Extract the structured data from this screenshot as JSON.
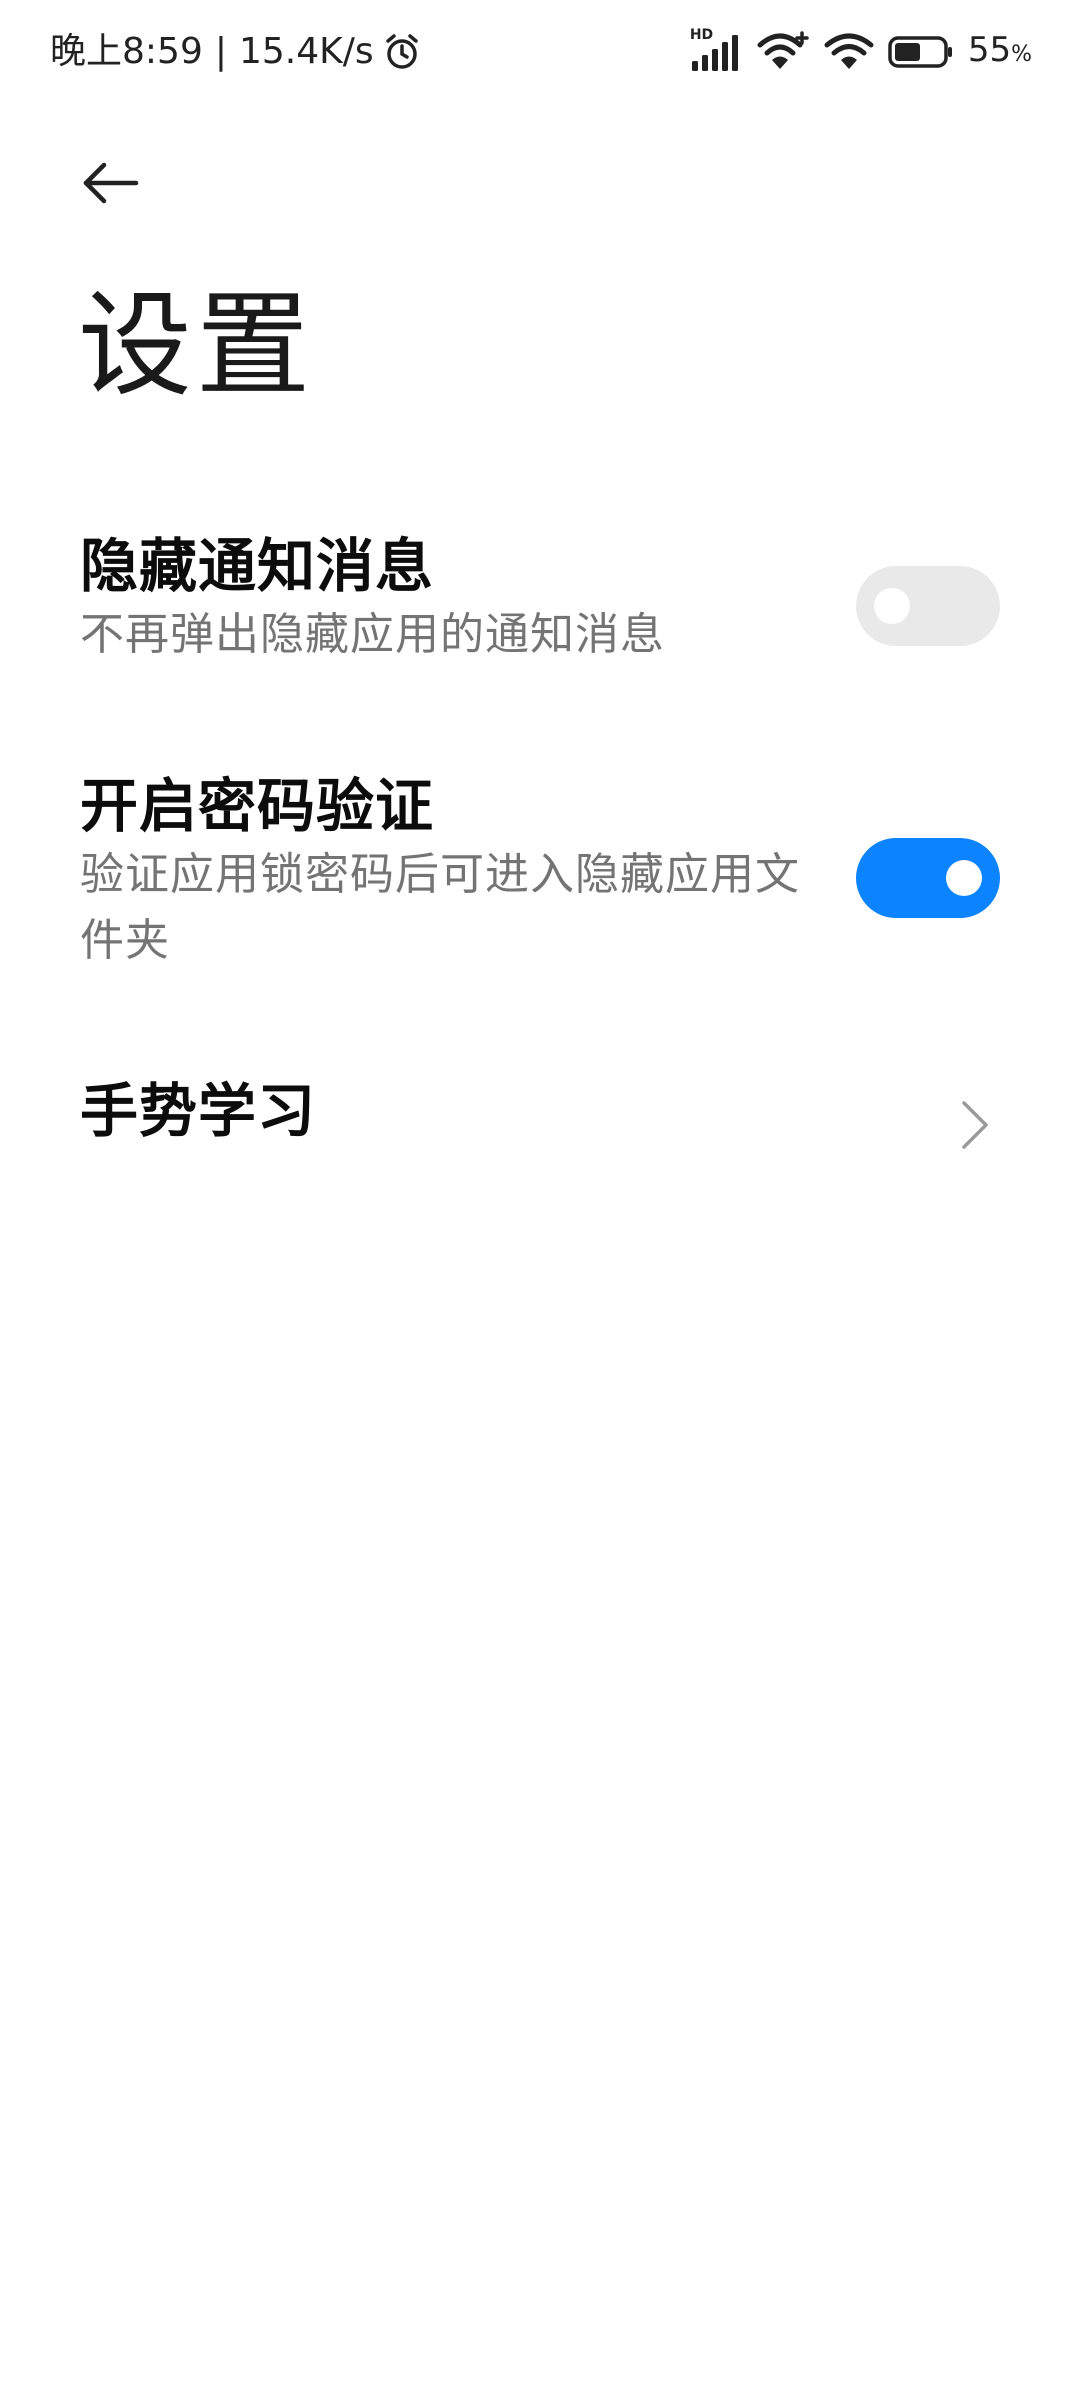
{
  "status_bar": {
    "time": "晚上8:59",
    "separator": "|",
    "net_speed": "15.4K/s",
    "alarm_icon": "alarm-clock-icon",
    "signal_badge": "HD",
    "battery_percent": "55",
    "battery_unit": "%",
    "battery_level": 0.55
  },
  "header": {
    "back_icon": "arrow-left-icon",
    "title": "设置"
  },
  "settings": {
    "hidden_notifications": {
      "title": "隐藏通知消息",
      "subtitle": "不再弹出隐藏应用的通知消息",
      "enabled": false
    },
    "password_verification": {
      "title": "开启密码验证",
      "subtitle": "验证应用锁密码后可进入隐藏应用文件夹",
      "enabled": true
    },
    "gesture_learning": {
      "title": "手势学习",
      "chevron_icon": "chevron-right-icon"
    }
  },
  "colors": {
    "accent": "#0d84ff",
    "toggle_off": "#e9e9e9",
    "title_text": "#0c0c0c",
    "subtitle_text": "#747474",
    "background": "#ffffff"
  }
}
